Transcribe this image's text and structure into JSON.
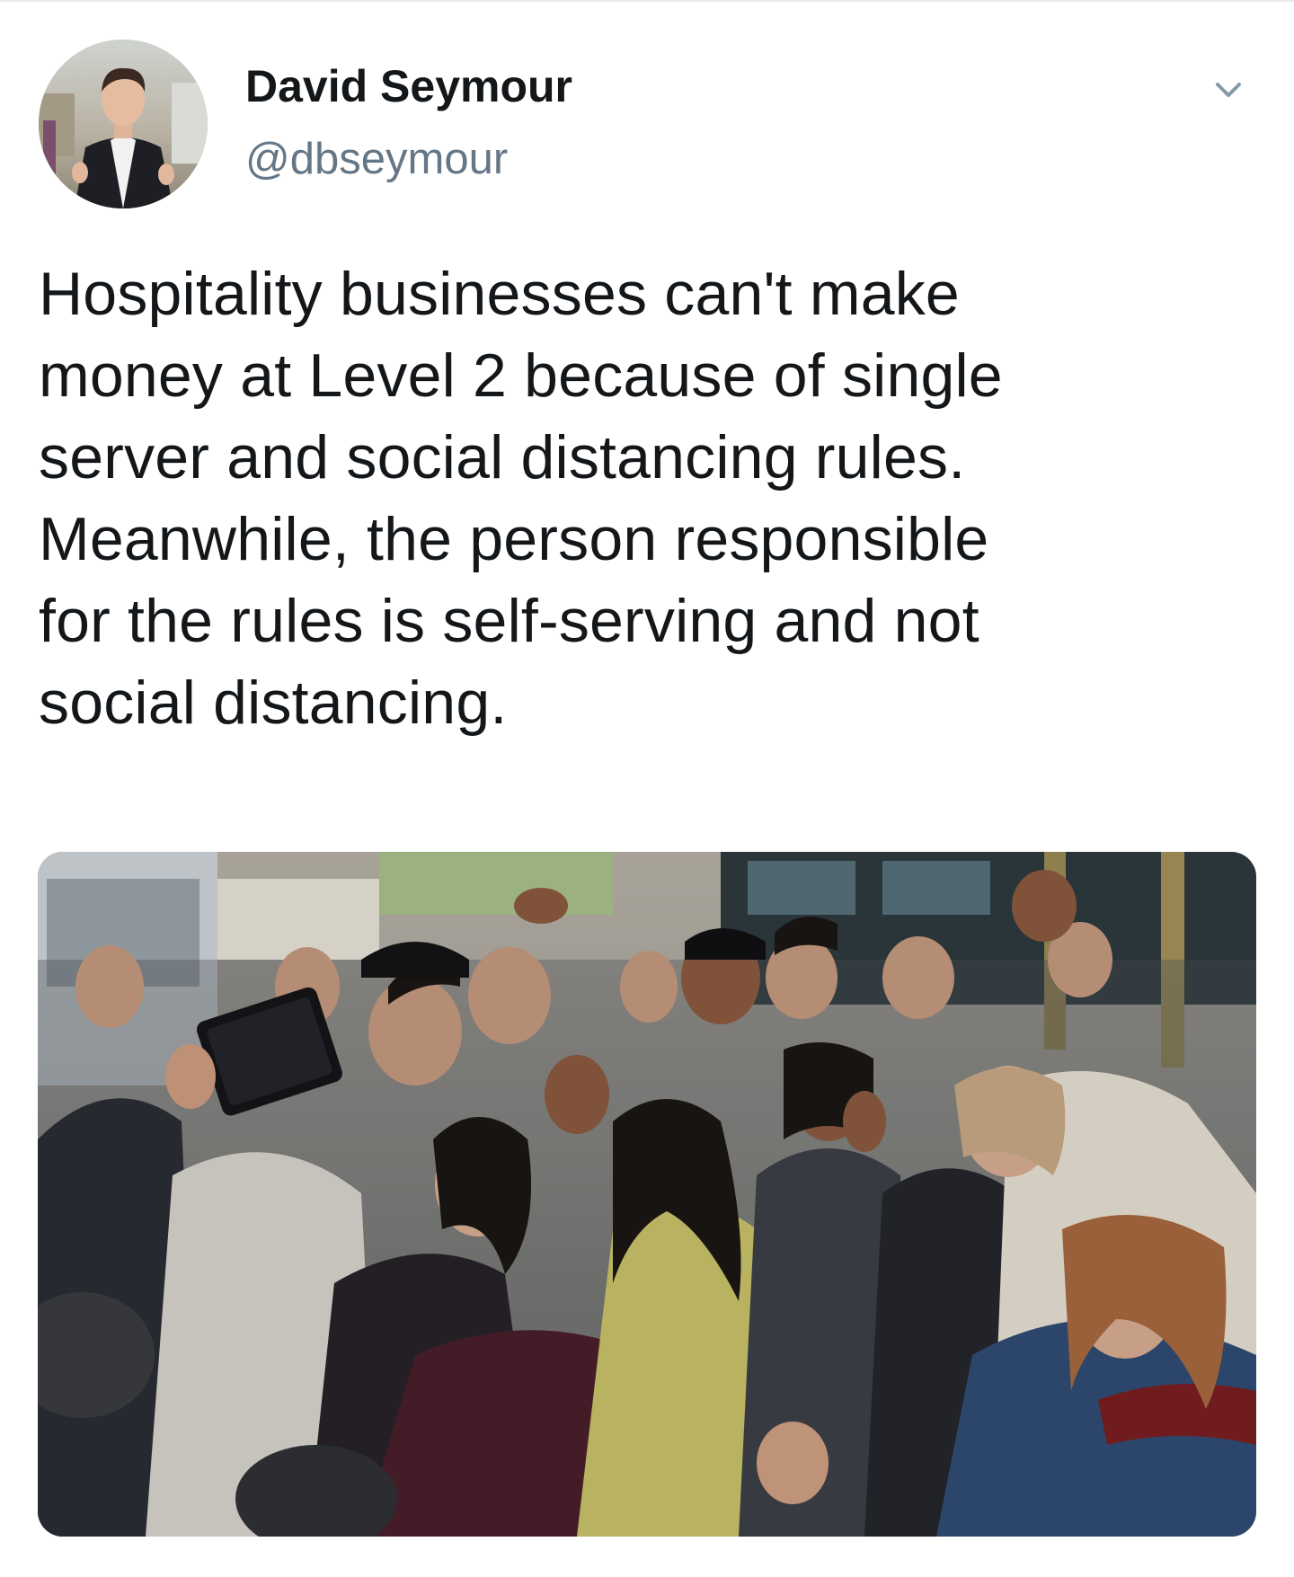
{
  "tweet": {
    "author": {
      "display_name": "David Seymour",
      "handle": "@dbseymour",
      "avatar_icon": "profile-photo"
    },
    "menu_icon": "chevron-down-icon",
    "text": "Hospitality businesses can't make\nmoney at Level 2 because of single\nserver and social distancing rules.\nMeanwhile, the person responsible\nfor the rules is self-serving and not\nsocial distancing.",
    "media": {
      "kind": "photo"
    }
  },
  "colors": {
    "text_primary": "#14171a",
    "text_secondary": "#657786",
    "divider": "#e6ecf0",
    "chevron": "#8899a6"
  }
}
